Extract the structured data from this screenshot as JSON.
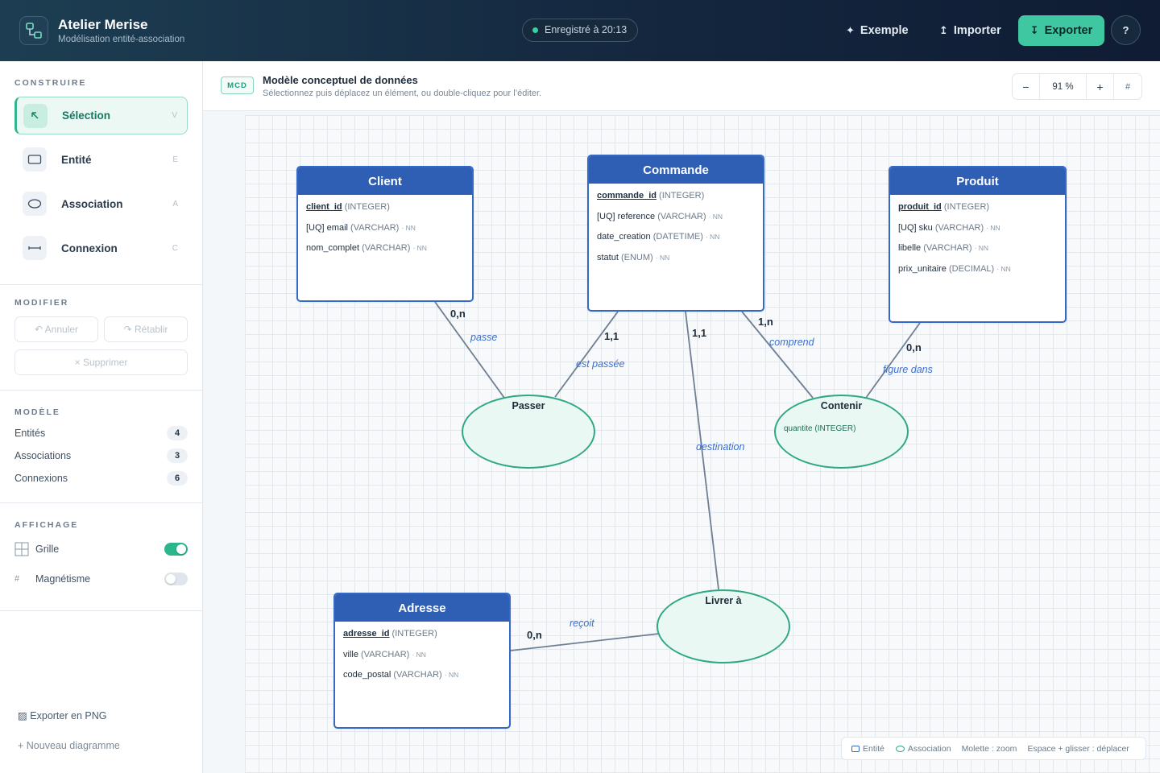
{
  "app": {
    "title": "Atelier Merise",
    "subtitle": "Modélisation entité-association",
    "save_status": "Enregistré à 20:13"
  },
  "header_actions": {
    "exemple": "Exemple",
    "importer": "Importer",
    "exporter": "Exporter",
    "help": "?"
  },
  "sidebar": {
    "construire_title": "CONSTRUIRE",
    "tools": [
      {
        "label": "Sélection",
        "key": "V",
        "active": true
      },
      {
        "label": "Entité",
        "key": "E",
        "active": false
      },
      {
        "label": "Association",
        "key": "A",
        "active": false
      },
      {
        "label": "Connexion",
        "key": "C",
        "active": false
      }
    ],
    "modifier_title": "MODIFIER",
    "annuler": "↶ Annuler",
    "retablir": "↷ Rétablir",
    "supprimer": "× Supprimer",
    "modele_title": "MODÈLE",
    "stats": [
      {
        "label": "Entités",
        "count": "4"
      },
      {
        "label": "Associations",
        "count": "3"
      },
      {
        "label": "Connexions",
        "count": "6"
      }
    ],
    "affichage_title": "AFFICHAGE",
    "grille_label": "Grille",
    "grille_on": true,
    "magnetisme_label": "Magnétisme",
    "magnetisme_on": false,
    "export_png": "▨ Exporter en PNG",
    "nouveau": "+ Nouveau diagramme"
  },
  "toolbar": {
    "badge": "MCD",
    "title": "Modèle conceptuel de données",
    "subtitle": "Sélectionnez puis déplacez un élément, ou double-cliquez pour l’éditer.",
    "zoom": "91 %",
    "zoom_out": "−",
    "zoom_in": "+",
    "grid_icon": "#"
  },
  "diagram": {
    "entities": {
      "client": {
        "name": "Client",
        "attributes": [
          {
            "prefix": "",
            "name": "client_id",
            "type": "(INTEGER)",
            "pk": true,
            "nn": ""
          },
          {
            "prefix": "[UQ] ",
            "name": "email",
            "type": "(VARCHAR)",
            "pk": false,
            "nn": "· NN"
          },
          {
            "prefix": "",
            "name": "nom_complet",
            "type": "(VARCHAR)",
            "pk": false,
            "nn": "· NN"
          }
        ]
      },
      "commande": {
        "name": "Commande",
        "attributes": [
          {
            "prefix": "",
            "name": "commande_id",
            "type": "(INTEGER)",
            "pk": true,
            "nn": ""
          },
          {
            "prefix": "[UQ] ",
            "name": "reference",
            "type": "(VARCHAR)",
            "pk": false,
            "nn": "· NN"
          },
          {
            "prefix": "",
            "name": "date_creation",
            "type": "(DATETIME)",
            "pk": false,
            "nn": "· NN"
          },
          {
            "prefix": "",
            "name": "statut",
            "type": "(ENUM)",
            "pk": false,
            "nn": "· NN"
          }
        ]
      },
      "produit": {
        "name": "Produit",
        "attributes": [
          {
            "prefix": "",
            "name": "produit_id",
            "type": "(INTEGER)",
            "pk": true,
            "nn": ""
          },
          {
            "prefix": "[UQ] ",
            "name": "sku",
            "type": "(VARCHAR)",
            "pk": false,
            "nn": "· NN"
          },
          {
            "prefix": "",
            "name": "libelle",
            "type": "(VARCHAR)",
            "pk": false,
            "nn": "· NN"
          },
          {
            "prefix": "",
            "name": "prix_unitaire",
            "type": "(DECIMAL)",
            "pk": false,
            "nn": "· NN"
          }
        ]
      },
      "adresse": {
        "name": "Adresse",
        "attributes": [
          {
            "prefix": "",
            "name": "adresse_id",
            "type": "(INTEGER)",
            "pk": true,
            "nn": ""
          },
          {
            "prefix": "",
            "name": "ville",
            "type": "(VARCHAR)",
            "pk": false,
            "nn": "· NN"
          },
          {
            "prefix": "",
            "name": "code_postal",
            "type": "(VARCHAR)",
            "pk": false,
            "nn": "· NN"
          }
        ]
      }
    },
    "associations": {
      "passer": {
        "name": "Passer",
        "attribute": ""
      },
      "contenir": {
        "name": "Contenir",
        "attribute": "quantite (INTEGER)"
      },
      "livrer": {
        "name": "Livrer à",
        "attribute": ""
      }
    },
    "links": {
      "client_passer": {
        "cardinality": "0,n",
        "role": "passe"
      },
      "commande_passer": {
        "cardinality": "1,1",
        "role": "est passée"
      },
      "commande_livrer": {
        "cardinality": "1,1",
        "role": "destination"
      },
      "commande_contenir": {
        "cardinality": "1,n",
        "role": "comprend"
      },
      "produit_contenir": {
        "cardinality": "0,n",
        "role": "figure dans"
      },
      "adresse_livrer": {
        "cardinality": "0,n",
        "role": "reçoit"
      }
    }
  },
  "legend": {
    "entite": "Entité",
    "association": "Association",
    "zoom_hint": "Molette : zoom",
    "pan_hint": "Espace + glisser : déplacer"
  },
  "colors": {
    "accent": "#3ec7a1",
    "entity_header": "#2f5fb5",
    "association_border": "#2ea783",
    "role_text": "#3b6fd0"
  }
}
